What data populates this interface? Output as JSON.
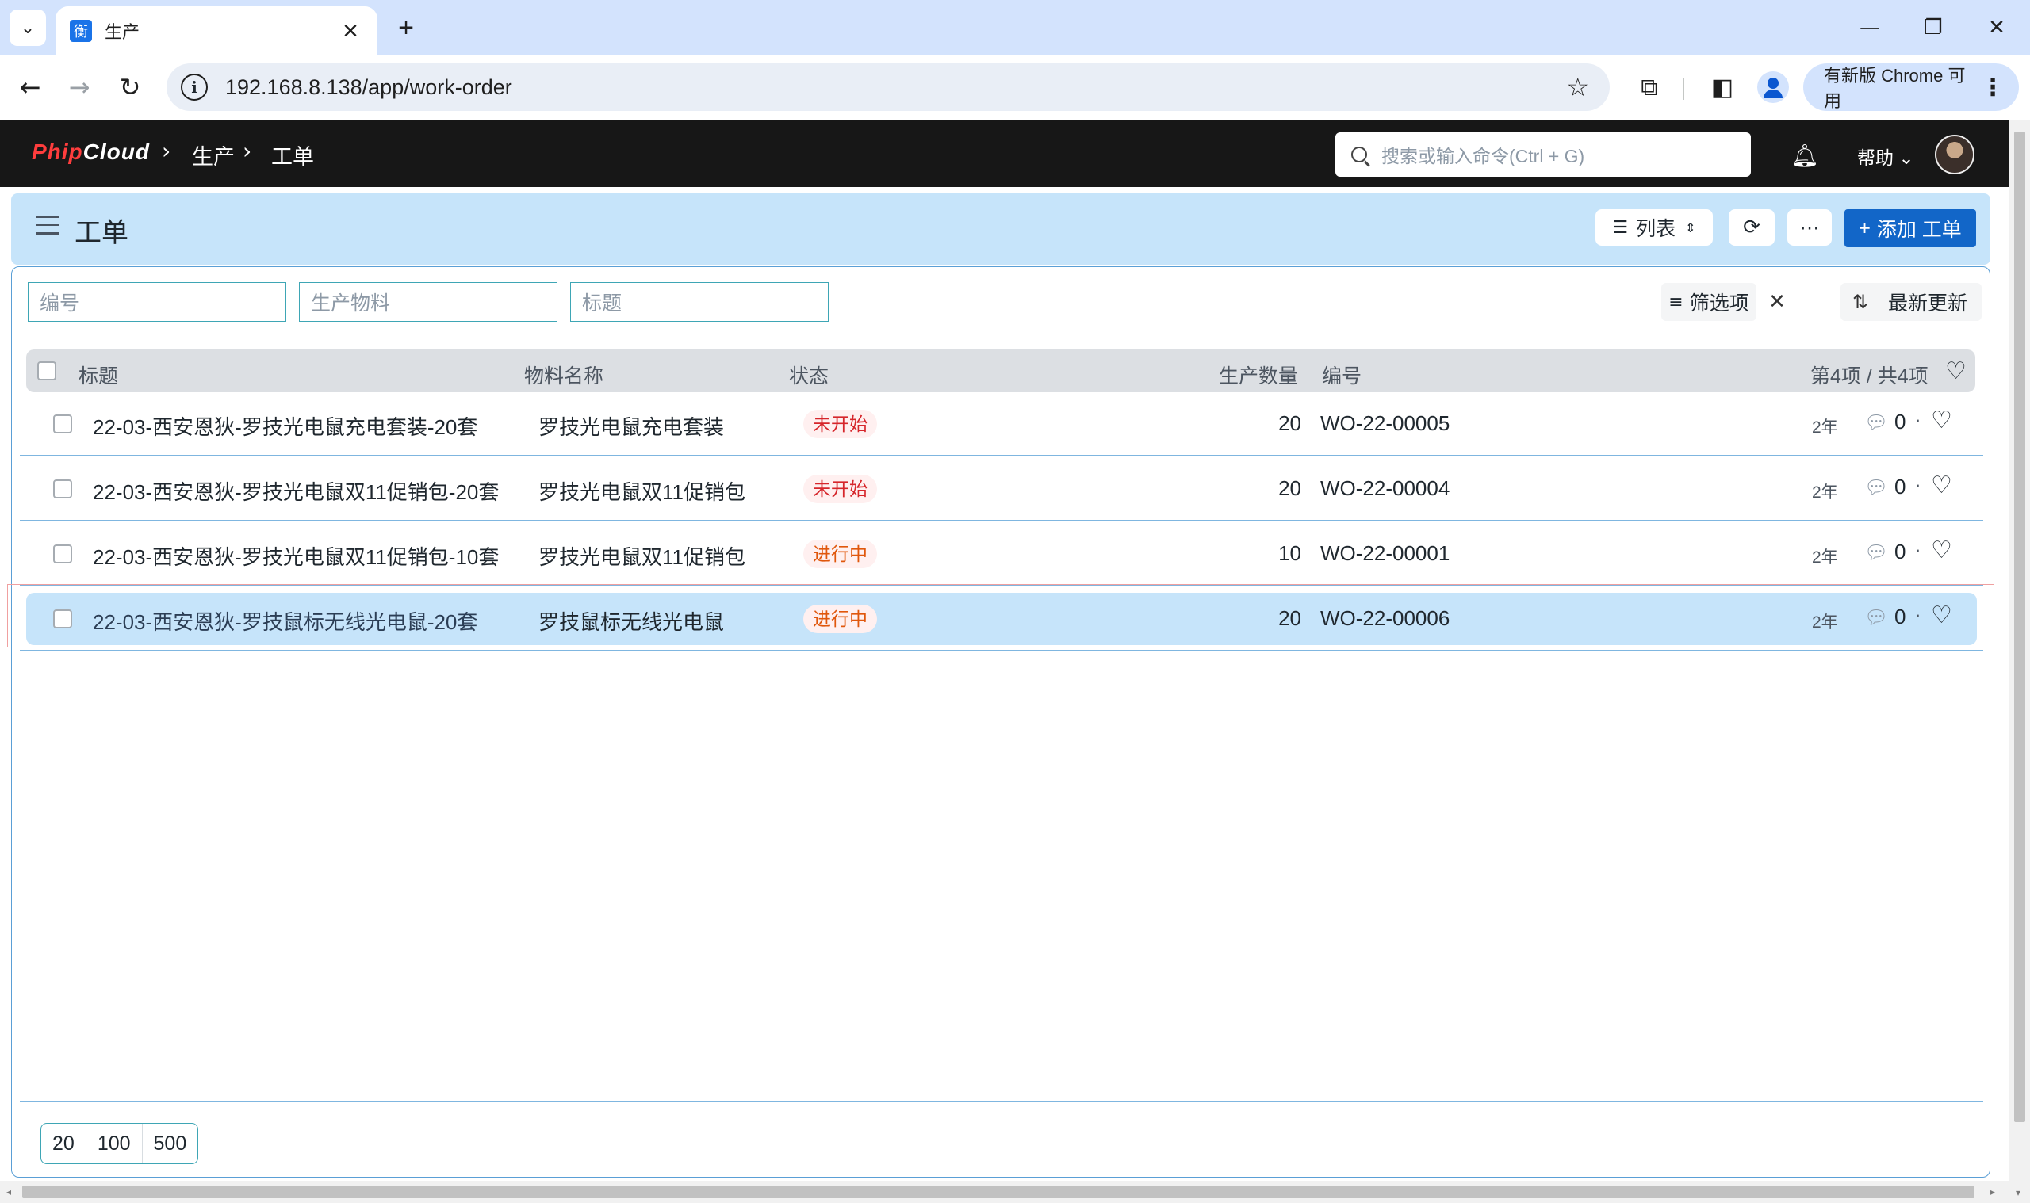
{
  "browser": {
    "tab_title": "生产",
    "favicon_glyph": "衡",
    "url": "192.168.8.138/app/work-order",
    "update_label": "有新版 Chrome 可用",
    "icons": [
      "chevron-down-icon",
      "close-icon",
      "plus-icon",
      "minimize-icon",
      "restore-icon",
      "back-icon",
      "forward-icon",
      "reload-icon",
      "info-icon",
      "star-icon",
      "extensions-icon",
      "side-panel-icon",
      "profile-icon",
      "more-vert-icon"
    ]
  },
  "navbar": {
    "logo_part1": "Phip",
    "logo_part2": "Cloud",
    "breadcrumbs": [
      "生产",
      "工单"
    ],
    "search_placeholder": "搜索或输入命令(Ctrl + G)",
    "help_label": "帮助"
  },
  "page": {
    "title": "工单",
    "view_label": "列表",
    "add_label": "添加 工单",
    "more_label": "···"
  },
  "filters": {
    "fields": [
      "编号",
      "生产物料",
      "标题"
    ],
    "filter_label": "筛选项",
    "sort_label": "最新更新"
  },
  "table": {
    "headers": {
      "title": "标题",
      "material": "物料名称",
      "status": "状态",
      "qty": "生产数量",
      "code": "编号",
      "count": "第4项 / 共4项"
    },
    "rows": [
      {
        "title": "22-03-西安恩狄-罗技光电鼠充电套装-20套",
        "material": "罗技光电鼠充电套装",
        "status": "未开始",
        "qty": "20",
        "code": "WO-22-00005",
        "age": "2年",
        "comments": "0"
      },
      {
        "title": "22-03-西安恩狄-罗技光电鼠双11促销包-20套",
        "material": "罗技光电鼠双11促销包",
        "status": "未开始",
        "qty": "20",
        "code": "WO-22-00004",
        "age": "2年",
        "comments": "0"
      },
      {
        "title": "22-03-西安恩狄-罗技光电鼠双11促销包-10套",
        "material": "罗技光电鼠双11促销包",
        "status": "进行中",
        "qty": "10",
        "code": "WO-22-00001",
        "age": "2年",
        "comments": "0"
      },
      {
        "title": "22-03-西安恩狄-罗技鼠标无线光电鼠-20套",
        "material": "罗技鼠标无线光电鼠",
        "status": "进行中",
        "qty": "20",
        "code": "WO-22-00006",
        "age": "2年",
        "comments": "0"
      }
    ]
  },
  "pager": {
    "sizes": [
      "20",
      "100",
      "500"
    ]
  },
  "colors": {
    "status_todo": "#d6262b",
    "status_doing": "#e0570c",
    "primary": "#1266c8",
    "highlight": "#c6e4fa"
  }
}
